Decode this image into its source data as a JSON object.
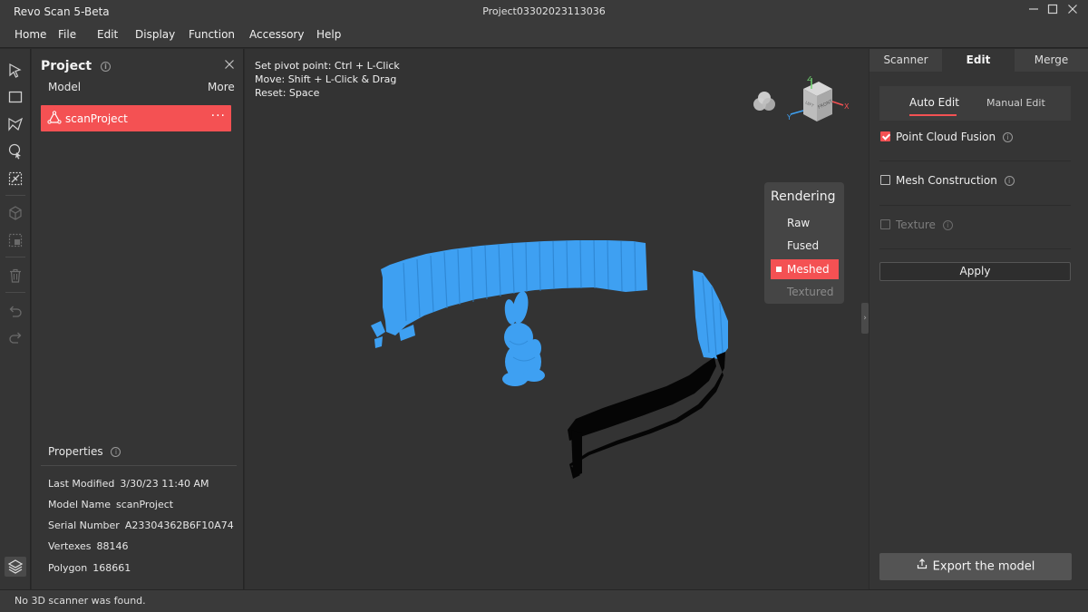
{
  "app": {
    "title": "Revo Scan 5-Beta",
    "project_name": "Project03302023113036"
  },
  "window_controls": [
    "minimize-icon",
    "maximize-icon",
    "close-icon"
  ],
  "menu": [
    "Home",
    "File",
    "Edit",
    "Display",
    "Function",
    "Accessory",
    "Help"
  ],
  "toolbar_icons": [
    "select-arrow-icon",
    "rectangle-select-icon",
    "lasso-select-icon",
    "brush-select-icon",
    "invert-select-icon",
    "box-hidden-icon",
    "crop-icon",
    "delete-icon",
    "undo-icon",
    "redo-icon",
    "layers-icon"
  ],
  "project_panel": {
    "title": "Project",
    "col_model": "Model",
    "col_more": "More",
    "model_item": {
      "name": "scanProject",
      "menu": "···"
    },
    "properties_title": "Properties",
    "properties": [
      {
        "label": "Last Modified",
        "value": "3/30/23 11:40 AM"
      },
      {
        "label": "Model Name",
        "value": "scanProject"
      },
      {
        "label": "Serial Number",
        "value": "A23304362B6F10A74"
      },
      {
        "label": "Vertexes",
        "value": "88146"
      },
      {
        "label": "Polygon",
        "value": "168661"
      }
    ]
  },
  "viewport": {
    "hints": [
      "Set pivot point:  Ctrl + L-Click",
      "Move:  Shift + L-Click & Drag",
      "Reset:  Space"
    ],
    "gizmo_labels": {
      "z": "Z",
      "x": "X",
      "y": "Y",
      "front": "FRONT",
      "left": "LEFT"
    },
    "rendering": {
      "title": "Rendering",
      "options": [
        {
          "label": "Raw",
          "state": "normal"
        },
        {
          "label": "Fused",
          "state": "normal"
        },
        {
          "label": "Meshed",
          "state": "active"
        },
        {
          "label": "Textured",
          "state": "disabled"
        }
      ]
    },
    "colors": {
      "scan": "#3ea0f2",
      "accent": "#f45153"
    }
  },
  "right_panel": {
    "tabs": [
      {
        "label": "Scanner",
        "active": false
      },
      {
        "label": "Edit",
        "active": true
      },
      {
        "label": "Merge",
        "active": false
      }
    ],
    "sub_tabs": {
      "auto": "Auto Edit",
      "manual": "Manual Edit"
    },
    "options": [
      {
        "label": "Point Cloud Fusion",
        "checked": true,
        "enabled": true
      },
      {
        "label": "Mesh Construction",
        "checked": false,
        "enabled": true
      },
      {
        "label": "Texture",
        "checked": false,
        "enabled": false
      }
    ],
    "apply_label": "Apply",
    "export_label": "Export the model"
  },
  "status": "No 3D scanner was found."
}
